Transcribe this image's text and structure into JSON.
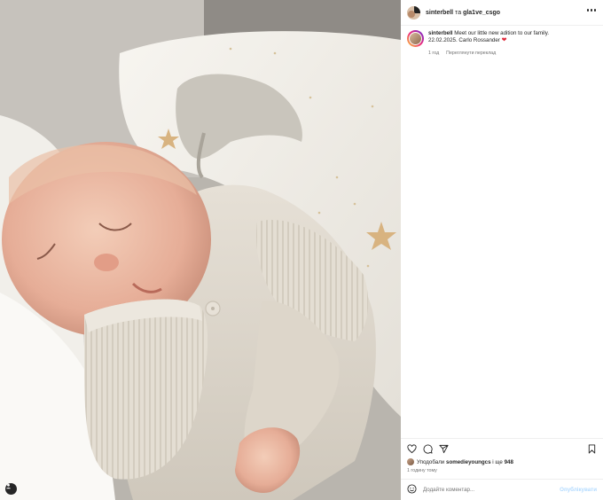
{
  "post": {
    "photo_alt": "",
    "tag_icon": "person-tag-icon"
  },
  "header": {
    "user1": "sinterbell",
    "separator": "та",
    "user2": "gla1ve_csgo",
    "more_icon": "more-horizontal-icon"
  },
  "caption": {
    "username": "sinterbell",
    "line1": "Meet our little new adition to our family.",
    "line2": "22.02.2025. Carlo Rossander",
    "heart": "❤",
    "age": "1 год",
    "translate": "Переглянути переклад"
  },
  "actions": {
    "like_icon": "heart-icon",
    "comment_icon": "comment-icon",
    "share_icon": "share-icon",
    "save_icon": "bookmark-icon"
  },
  "likes": {
    "prefix": "Уподобали",
    "user": "somedieyoungcs",
    "and_others": "і ще",
    "count": "948"
  },
  "time_ago": "1 годину тому",
  "comment": {
    "emoji_icon": "emoji-icon",
    "placeholder": "Додайте коментар...",
    "publish": "Опублікувати"
  },
  "colors": {
    "accent": "#0095f6",
    "publish_disabled": "#b3dbff",
    "heart": "#e0293b"
  }
}
